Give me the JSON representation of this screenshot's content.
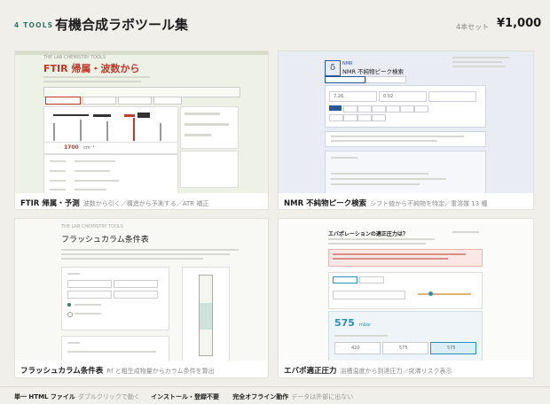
{
  "header": {
    "tag": "4 TOOLS",
    "title": "有機合成ラボツール集",
    "count": "4本セット",
    "price": "¥1,000"
  },
  "cards": [
    {
      "name": "FTIR 帰属・予測",
      "desc": "波数から引く／構造から予測する／ATR 補正",
      "thumb_title": "FTIR 帰属・波数から"
    },
    {
      "name": "NMR 不純物ピーク検索",
      "desc": "シフト値から不純物を特定／重溶媒 13 種",
      "thumb_title": "NMR 不純物ピーク検索"
    },
    {
      "name": "フラッシュカラム条件表",
      "desc": "Rf と粗生成物量からカラム条件を算出",
      "thumb_title": "フラッシュカラム条件表"
    },
    {
      "name": "エバポ適正圧力",
      "desc": "浴槽温度から到達圧力／突沸リスク表示",
      "thumb_title": "エバポレーションの適正圧力は？"
    }
  ],
  "thumb_text": {
    "ftir_value": "1700",
    "ftir_unit": "cm⁻¹",
    "nmr_val_1": "7.26",
    "nmr_val_2": "0.02",
    "evap_value": "575",
    "evap_unit": "mbar",
    "evap_cells": [
      "420",
      "575",
      "575"
    ]
  },
  "footer": [
    {
      "bold": "単一 HTML ファイル",
      "gray": "ダブルクリックで動く"
    },
    {
      "bold": "インストール・登録不要",
      "gray": ""
    },
    {
      "bold": "完全オフライン動作",
      "gray": "データは外部に出ない"
    }
  ],
  "colors": {
    "accent": "#2f7a6a",
    "ftir_red": "#c0392b",
    "nmr_blue": "#2b5797",
    "evap_teal": "#2a8fb5"
  }
}
